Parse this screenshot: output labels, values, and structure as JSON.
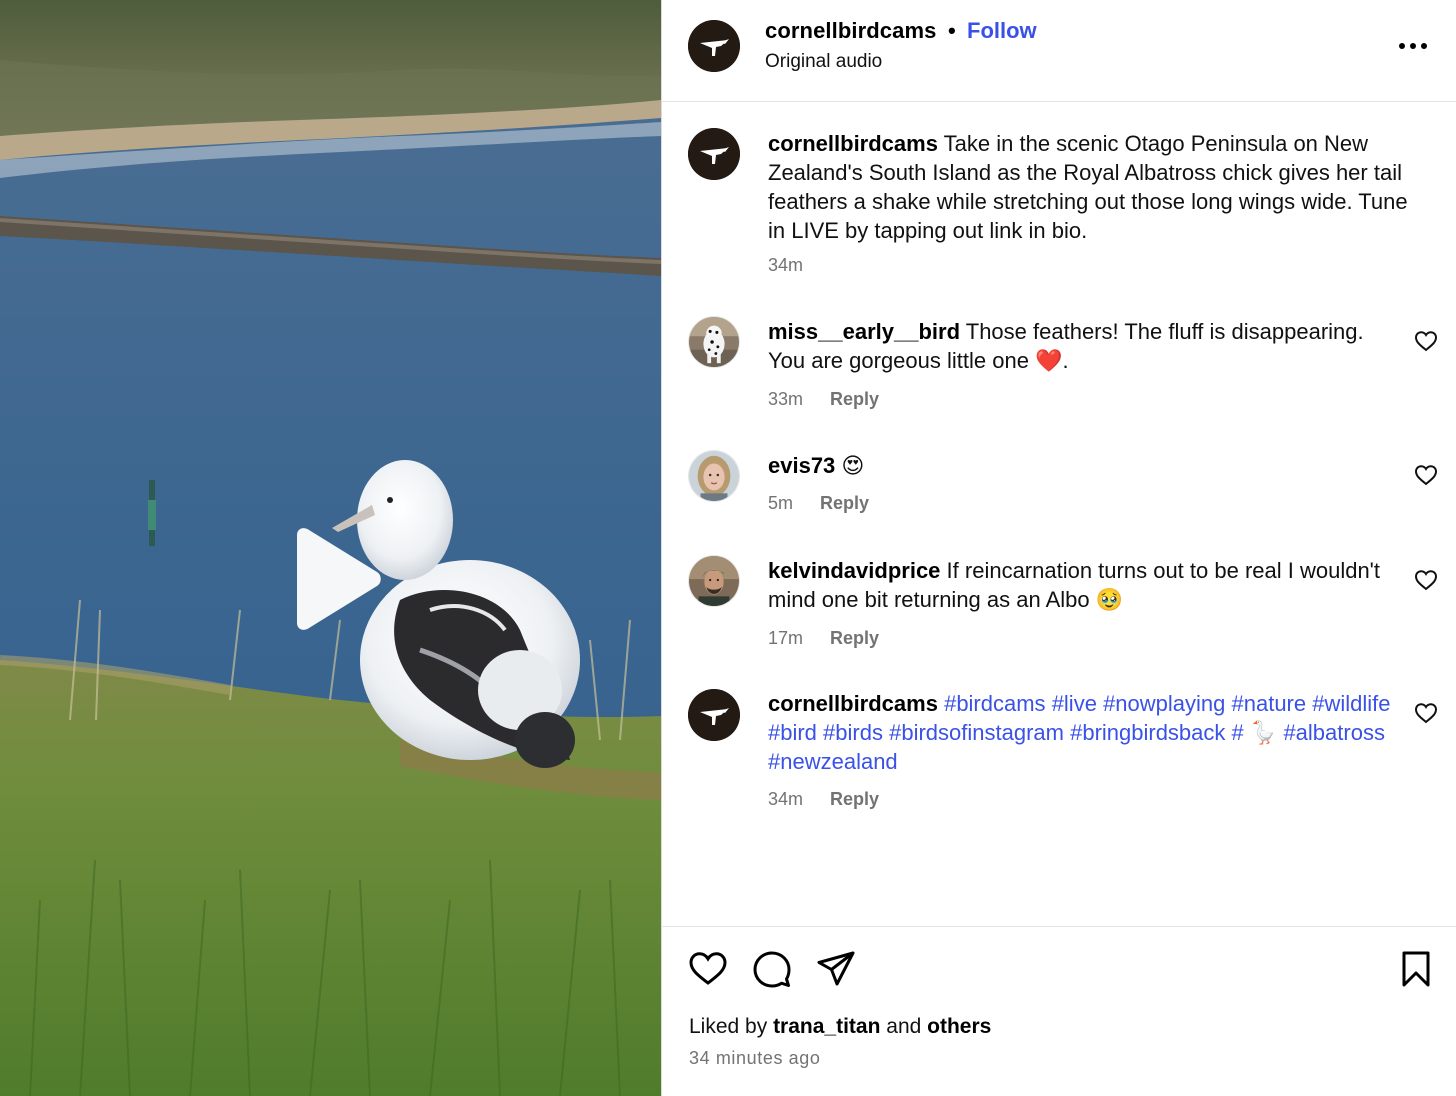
{
  "post": {
    "username": "cornellbirdcams",
    "separator": "•",
    "follow_label": "Follow",
    "audio_label": "Original audio",
    "more_icon": "more-horizontal-icon"
  },
  "caption": {
    "username": "cornellbirdcams",
    "text": "Take in the scenic Otago Peninsula on New Zealand's South Island as the Royal Albatross chick gives her tail feathers a shake while stretching out those long wings wide. Tune in LIVE by tapping out link in bio.",
    "time": "34m"
  },
  "comments": [
    {
      "username": "miss__early__bird",
      "text": "Those feathers! The fluff is disappearing. You are gorgeous little one",
      "emoji": "❤️",
      "trail": ".",
      "time": "33m",
      "reply_label": "Reply"
    },
    {
      "username": "evis73",
      "emoji": "😍",
      "time": "5m",
      "reply_label": "Reply"
    },
    {
      "username": "kelvindavidprice",
      "text": "If reincarnation turns out to be real I wouldn't mind one bit returning as an Albo",
      "emoji": "🥹",
      "time": "17m",
      "reply_label": "Reply"
    },
    {
      "username": "cornellbirdcams",
      "tags_a": [
        "#birdcams",
        "#live",
        "#nowplaying",
        "#nature",
        "#wildlife",
        "#bird",
        "#birds",
        "#birdsofinstagram",
        "#bringbirdsback",
        "#"
      ],
      "emoji": "🪿",
      "tags_b": [
        "#albatross",
        "#newzealand"
      ],
      "time": "34m",
      "reply_label": "Reply"
    }
  ],
  "footer": {
    "liked_by_prefix": "Liked by",
    "liked_by_user": "trana_titan",
    "liked_by_and": "and",
    "liked_by_others": "others",
    "time_ago": "34 minutes ago"
  },
  "colors": {
    "link_blue": "#3a51e8",
    "meta_gray": "#737373",
    "divider": "#dbdbdb"
  }
}
